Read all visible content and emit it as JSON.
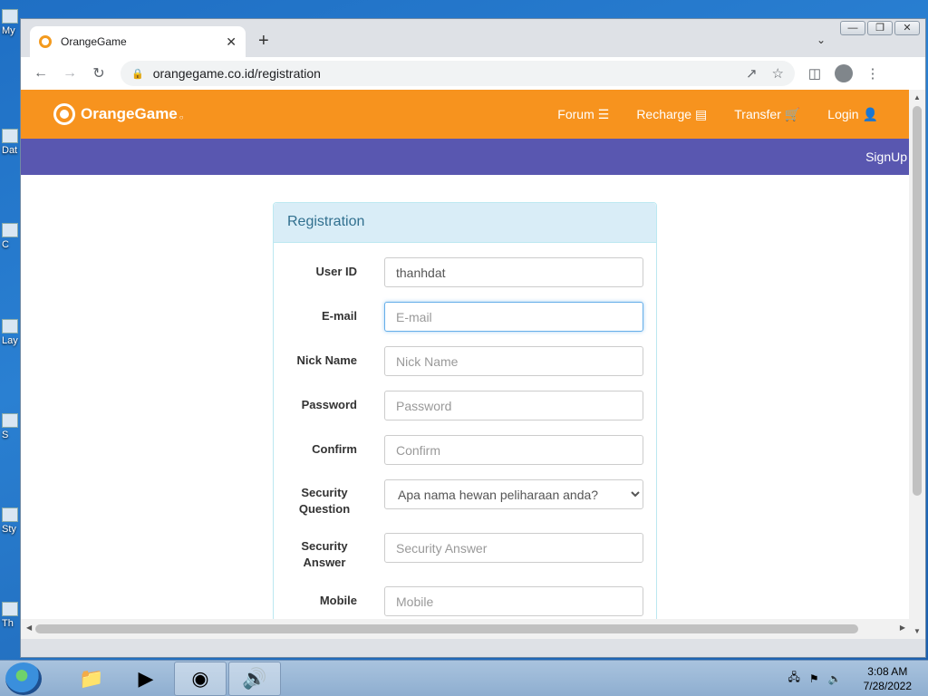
{
  "desktop": {
    "icons": [
      "My",
      "Dat",
      "C",
      "Lay",
      "S",
      "Sty",
      "Th"
    ]
  },
  "browser": {
    "tab_title": "OrangeGame",
    "url": "orangegame.co.id/registration",
    "icons": {
      "back": "arrow-left-icon",
      "forward": "arrow-right-icon",
      "reload": "reload-icon",
      "lock": "lock-icon",
      "share": "share-icon",
      "bookmark": "star-icon",
      "sidepanel": "side-panel-icon",
      "profile": "profile-icon",
      "menu": "kebab-menu-icon"
    }
  },
  "site": {
    "logo": "OrangeGame",
    "nav": [
      {
        "label": "Forum",
        "icon": "menu-icon"
      },
      {
        "label": "Recharge",
        "icon": "credit-card-icon"
      },
      {
        "label": "Transfer",
        "icon": "cart-icon"
      },
      {
        "label": "Login",
        "icon": "user-icon"
      }
    ],
    "signup": "SignUp",
    "colors": {
      "header": "#f7931e",
      "subbar": "#5957b0",
      "panel_head": "#d9edf7"
    }
  },
  "form": {
    "title": "Registration",
    "fields": [
      {
        "label": "User ID",
        "value": "thanhdat",
        "placeholder": ""
      },
      {
        "label": "E-mail",
        "value": "",
        "placeholder": "E-mail"
      },
      {
        "label": "Nick Name",
        "value": "",
        "placeholder": "Nick Name"
      },
      {
        "label": "Password",
        "value": "",
        "placeholder": "Password"
      },
      {
        "label": "Confirm",
        "value": "",
        "placeholder": "Confirm"
      },
      {
        "label": "Security Question",
        "value": "Apa nama hewan peliharaan anda?",
        "placeholder": ""
      },
      {
        "label": "Security Answer",
        "value": "",
        "placeholder": "Security Answer"
      },
      {
        "label": "Mobile",
        "value": "",
        "placeholder": "Mobile"
      }
    ]
  },
  "taskbar": {
    "time": "3:08 AM",
    "date": "7/28/2022"
  }
}
